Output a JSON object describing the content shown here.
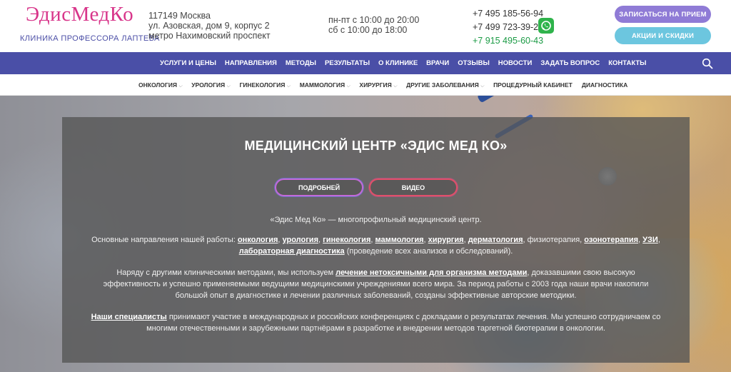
{
  "header": {
    "logo": "ЭдисМедКо",
    "tagline": "КЛИНИКА ПРОФЕССОРА ЛАПТЕВА",
    "address": [
      "117149 Москва",
      "ул. Азовская, дом 9, корпус 2",
      "метро Нахимовский проспект"
    ],
    "hours": [
      "пн-пт с 10:00 до 20:00",
      "сб с 10:00 до 18:00"
    ],
    "phones": [
      "+7 495 185-56-94",
      "+7 499 723-39-28",
      "+7 915 495-60-43"
    ],
    "whatsapp_icon": "whatsapp-icon",
    "buttons": {
      "appoint": "ЗАПИСАТЬСЯ НА ПРИЕМ",
      "promo": "АКЦИИ И СКИДКИ"
    },
    "colors": {
      "logo": "#d8358a",
      "tagline": "#4b4ea6",
      "appoint_btn": "#8f7bd6",
      "promo_btn": "#6cc6df",
      "green_phone": "#1b9b45"
    }
  },
  "nav_main": {
    "items": [
      "УСЛУГИ И ЦЕНЫ",
      "НАПРАВЛЕНИЯ",
      "МЕТОДЫ",
      "РЕЗУЛЬТАТЫ",
      "О КЛИНИКЕ",
      "ВРАЧИ",
      "ОТЗЫВЫ",
      "НОВОСТИ",
      "ЗАДАТЬ ВОПРОС",
      "КОНТАКТЫ"
    ],
    "search_icon": "search-icon",
    "color": "#4a4fa7"
  },
  "nav_sub": {
    "items": [
      "ОНКОЛОГИЯ",
      "УРОЛОГИЯ",
      "ГИНЕКОЛОГИЯ",
      "МАММОЛОГИЯ",
      "ХИРУРГИЯ",
      "ДРУГИЕ ЗАБОЛЕВАНИЯ",
      "ПРОЦЕДУРНЫЙ КАБИНЕТ",
      "ДИАГНОСТИКА"
    ]
  },
  "hero": {
    "title": "МЕДИЦИНСКИЙ ЦЕНТР «ЭДИС МЕД КО»",
    "btn_more": "ПОДРОБНЕЙ",
    "btn_video": "ВИДЕО",
    "p1": "«Эдис Мед Ко» — многопрофильный медицинский центр.",
    "p2": {
      "t0": "Основные направления нашей работы: ",
      "l1": "онкология",
      "l2": "урология",
      "l3": "гинекология",
      "l4": "маммология",
      "l5": "хирургия",
      "l6": "дерматология",
      "t1": ", физиотерапия, ",
      "l7": "озонотерапия",
      "l8": "УЗИ",
      "l9": "лабораторная диагностика",
      "t2": " (проведение всех анализов и обследований)."
    },
    "p3": {
      "t0": "Наряду с другими клиническими методами, мы используем ",
      "l1": "лечение нетоксичными для организма методами",
      "t1": ", доказавшими свою высокую эффективность и успешно применяемыми ведущими медицинскими учреждениями всего мира. За период работы с 2003 года наши врачи накопили большой опыт в диагностике и лечении различных заболеваний, созданы эффективные авторские методики."
    },
    "p4": {
      "l1": "Наши специалисты",
      "t1": " принимают участие в международных и российских конференциях с докладами о результатах лечения. Мы успешно сотрудничаем со многими отечественными и зарубежными партнёрами в разработке и внедрении методов таргетной биотерапии в онкологии."
    }
  }
}
